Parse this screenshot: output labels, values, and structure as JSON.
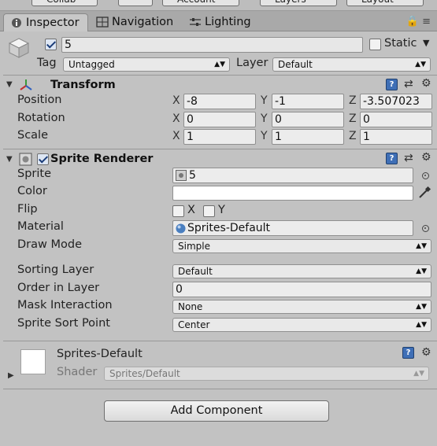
{
  "toolbar": {
    "collab_label": "Collab",
    "account_label": "Account",
    "layers_label": "Layers",
    "layout_label": "Layout"
  },
  "tabs": [
    {
      "label": "Inspector",
      "icon": "info-icon",
      "active": true
    },
    {
      "label": "Navigation",
      "icon": "navigation-icon",
      "active": false
    },
    {
      "label": "Lighting",
      "icon": "lighting-icon",
      "active": false
    }
  ],
  "object": {
    "name": "5",
    "active": true,
    "static_label": "Static",
    "tag_label": "Tag",
    "tag_value": "Untagged",
    "layer_label": "Layer",
    "layer_value": "Default"
  },
  "transform": {
    "title": "Transform",
    "rows": [
      {
        "label": "Position",
        "x": "-8",
        "y": "-1",
        "z": "-3.507023"
      },
      {
        "label": "Rotation",
        "x": "0",
        "y": "0",
        "z": "0"
      },
      {
        "label": "Scale",
        "x": "1",
        "y": "1",
        "z": "1"
      }
    ]
  },
  "axes": {
    "x": "X",
    "y": "Y",
    "z": "Z"
  },
  "sprite_renderer": {
    "title": "Sprite Renderer",
    "enabled": true,
    "sprite_label": "Sprite",
    "sprite_value": "5",
    "color_label": "Color",
    "color_value": "#ffffff",
    "flip_label": "Flip",
    "flip_x": "X",
    "flip_y": "Y",
    "material_label": "Material",
    "material_value": "Sprites-Default",
    "draw_mode_label": "Draw Mode",
    "draw_mode_value": "Simple",
    "sorting_layer_label": "Sorting Layer",
    "sorting_layer_value": "Default",
    "order_label": "Order in Layer",
    "order_value": "0",
    "mask_label": "Mask Interaction",
    "mask_value": "None",
    "sort_point_label": "Sprite Sort Point",
    "sort_point_value": "Center"
  },
  "material_preview": {
    "name": "Sprites-Default",
    "shader_label": "Shader",
    "shader_value": "Sprites/Default"
  },
  "add_component_label": "Add Component",
  "colors": {
    "help_icon": "#3f6fb6",
    "panel_bg": "#c2c2c2",
    "tab_bar": "#a9a9a9"
  }
}
